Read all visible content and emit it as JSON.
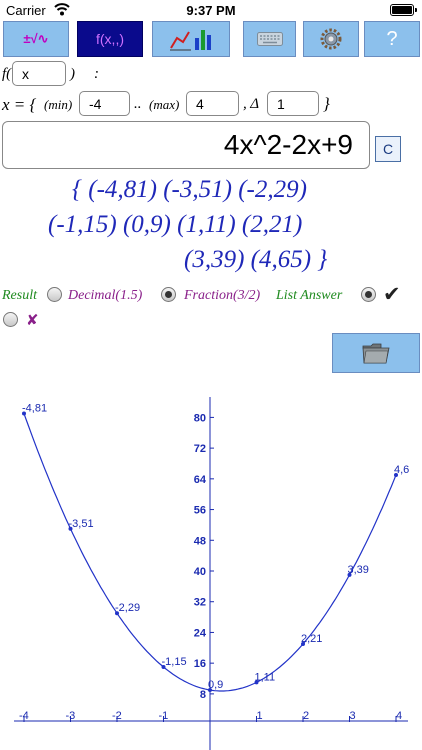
{
  "status_bar": {
    "carrier": "Carrier",
    "time": "9:37 PM"
  },
  "toolbar": {
    "buttons": [
      {
        "label": "±√∿"
      },
      {
        "label": "f(x,,)"
      },
      {
        "label": ""
      },
      {
        "label": ""
      },
      {
        "label": ""
      },
      {
        "label": "?"
      }
    ]
  },
  "function_row": {
    "prefix": "f(",
    "variable": "x",
    "suffix": ")",
    "colon": ":"
  },
  "range_row": {
    "lead": "x = {",
    "min_label": "(min)",
    "min_value": "-4",
    "dots": "..",
    "max_label": "(max)",
    "max_value": "4",
    "delta_label": ", Δ",
    "delta_value": "1",
    "close": "}"
  },
  "expression": "4x^2-2x+9",
  "clear_label": "C",
  "result_lines": [
    "{ (-4,81) (-3,51) (-2,29)",
    "(-1,15) (0,9) (1,11) (2,21)",
    "(3,39) (4,65) }"
  ],
  "options": {
    "result_label": "Result",
    "decimal_label": "Decimal(1.5)",
    "fraction_label": "Fraction(3/2)",
    "list_answer_label": "List Answer",
    "check_mark": "✔",
    "cross_mark": "✘"
  },
  "colors": {
    "accent_green": "#1e8a1e",
    "accent_purple": "#8a208a",
    "result_blue": "#1f28b8",
    "curve_blue": "#2233c8"
  },
  "chart_data": {
    "type": "line",
    "x": [
      -4,
      -3,
      -2,
      -1,
      0,
      1,
      2,
      3,
      4
    ],
    "y": [
      81,
      51,
      29,
      15,
      9,
      11,
      21,
      39,
      65
    ],
    "point_labels": [
      "-4,81",
      "-3,51",
      "-2,29",
      "-1,15",
      "0,9",
      "1,11",
      "2,21",
      "3,39",
      "4,6"
    ],
    "x_ticks": [
      "-4",
      "-3",
      "-2",
      "-1",
      "0",
      "1",
      "2",
      "3",
      "4"
    ],
    "y_ticks": [
      "8",
      "16",
      "24",
      "32",
      "40",
      "48",
      "56",
      "64",
      "72",
      "80"
    ],
    "y_tick_values": [
      8,
      16,
      24,
      32,
      40,
      48,
      56,
      64,
      72,
      80
    ],
    "xlim": [
      -4.2,
      4.2
    ],
    "ylim": [
      -5,
      85
    ],
    "grid": false
  }
}
